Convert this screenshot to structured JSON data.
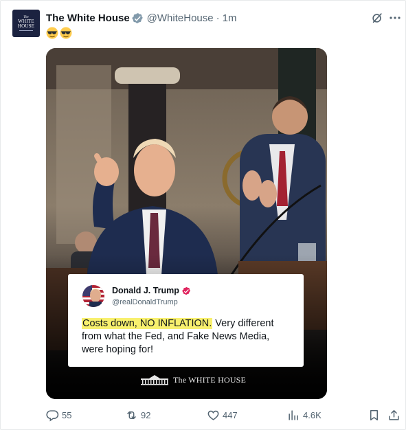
{
  "author": {
    "display_name": "The White House",
    "handle": "@WhiteHouse",
    "separator": "·",
    "time": "1m",
    "avatar_text": {
      "small": "The",
      "line1": "WHITE",
      "line2": "HOUSE"
    }
  },
  "post": {
    "emoji": [
      "smiling-face-with-sunglasses",
      "smiling-face-with-sunglasses"
    ]
  },
  "media": {
    "quote": {
      "name": "Donald J. Trump",
      "handle": "@realDonaldTrump",
      "highlighted_text": "Costs down, NO INFLATION.",
      "text": " Very different from what the Fed, and Fake News Media, were hoping for!"
    },
    "footer_label": "The WHITE HOUSE"
  },
  "actions": {
    "replies": "55",
    "reposts": "92",
    "likes": "447",
    "views": "4.6K"
  },
  "colors": {
    "verified_badge": "#829aab",
    "quote_badge": "#e0245e",
    "highlight": "#f8f06e",
    "muted_text": "#536471"
  }
}
